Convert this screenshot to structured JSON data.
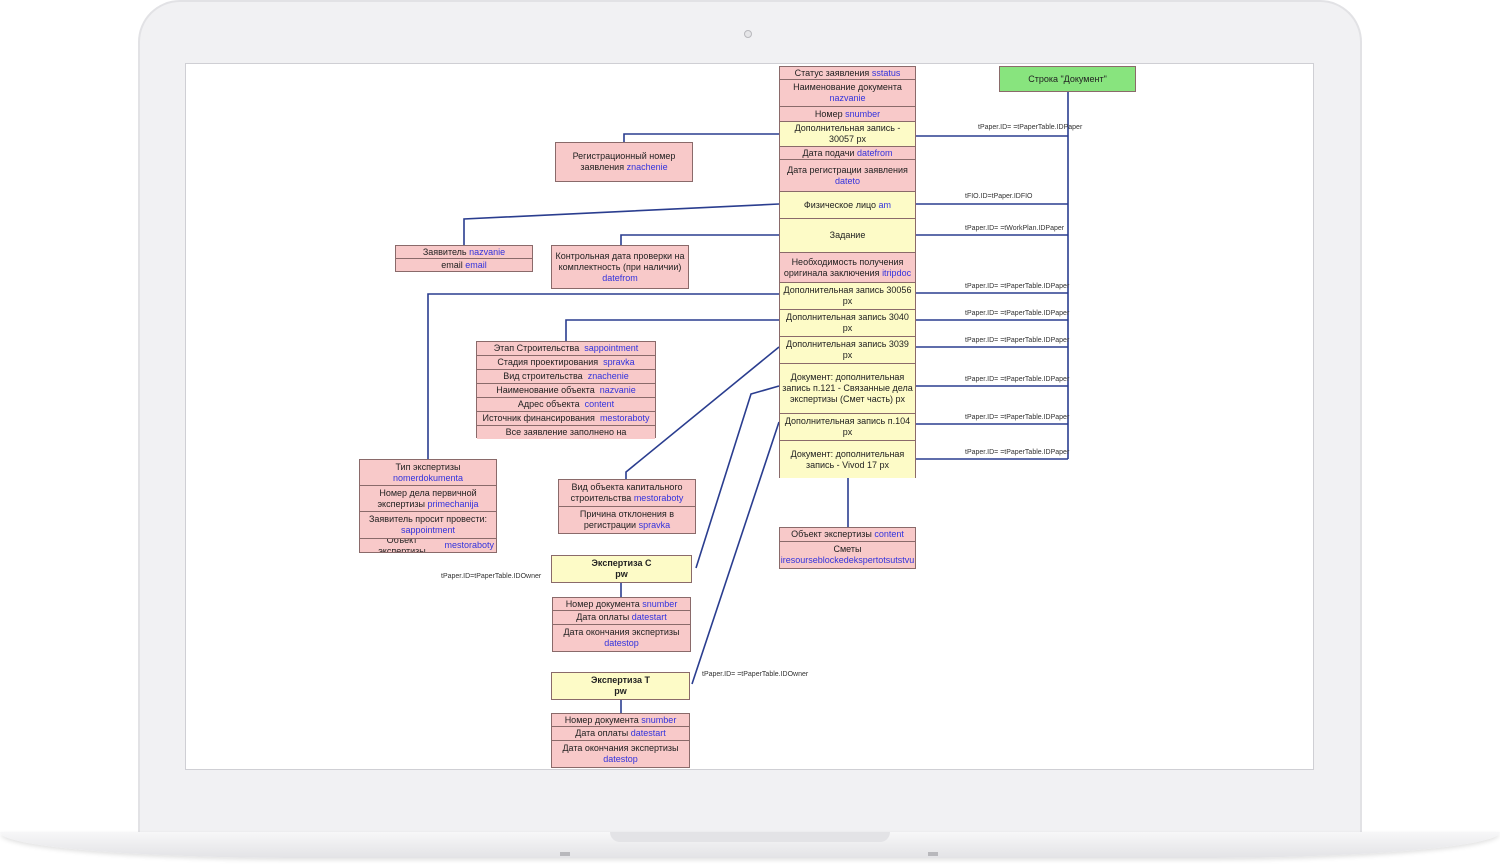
{
  "colors": {
    "pink": "#f8c9c9",
    "yellow": "#fdfbc7",
    "green": "#88e47e",
    "line": "#2a3d8f",
    "field": "#3333dd"
  },
  "document": {
    "title": "Строка \"Документ\""
  },
  "main_rows": [
    {
      "text": "Статус заявления",
      "field": "sstatus"
    },
    {
      "text": "Наименование документа",
      "field": "nazvanie"
    },
    {
      "text": "Номер",
      "field": "snumber"
    },
    {
      "text": "Дополнительная запись - 30057 px",
      "field": ""
    },
    {
      "text": "Дата подачи",
      "field": "datefrom"
    },
    {
      "text": "Дата регистрации заявления",
      "field": "dateto"
    },
    {
      "text": "Физическое лицо",
      "field": "am"
    },
    {
      "text": "Задание",
      "field": ""
    },
    {
      "text": "Необходимость получения оригинала заключения",
      "field": "itripdoc"
    },
    {
      "text": "Дополнительная запись 30056 px",
      "field": ""
    },
    {
      "text": "Дополнительная запись 3040 px",
      "field": ""
    },
    {
      "text": "Дополнительная запись 3039 px",
      "field": ""
    },
    {
      "text": "Документ: дополнительная запись п.121 - Связанные дела экспертизы (Смет часть) px",
      "field": ""
    },
    {
      "text": "Дополнительная запись п.104 px",
      "field": ""
    },
    {
      "text": "Документ: дополнительная запись - Vivod 17 px",
      "field": ""
    }
  ],
  "reg_number": [
    {
      "text": "Регистрационный номер заявления",
      "field": "znachenie"
    }
  ],
  "applicant": [
    {
      "text": "Заявитель",
      "field": "nazvanie"
    },
    {
      "text": "email",
      "field": "email"
    }
  ],
  "control_date": [
    {
      "text": "Контрольная дата проверки на комплектность (при наличии)",
      "field": "datefrom"
    }
  ],
  "stage": [
    {
      "text": "Этап Строительства",
      "field": "sappointment"
    },
    {
      "text": "Стадия проектирования",
      "field": "spravka"
    },
    {
      "text": "Вид строительства",
      "field": "znachenie"
    },
    {
      "text": "Наименование объекта",
      "field": "nazvanie"
    },
    {
      "text": "Адрес объекта",
      "field": "content"
    },
    {
      "text": "Источник финансирования",
      "field": "mestoraboty"
    },
    {
      "text": "Все заявление заполнено на",
      "field": ""
    }
  ],
  "type_block": [
    {
      "text": "Тип экспертизы",
      "field": "nomerdokumenta"
    },
    {
      "text": "Номер дела первичной экспертизы",
      "field": "primechanija"
    },
    {
      "text": "Заявитель просит провести:",
      "field": "sappointment"
    },
    {
      "text": "Объект экспертизы",
      "field": "mestoraboty"
    }
  ],
  "object_kind": [
    {
      "text": "Вид объекта капитального строительства",
      "field": "mestoraboty"
    },
    {
      "text": "Причина отклонения в регистрации",
      "field": "spravka"
    }
  ],
  "expertise_object": [
    {
      "text": "Объект экспертизы",
      "field": "content"
    },
    {
      "text": "Сметы",
      "field": "iresourseblockedekspertotsutstvu"
    }
  ],
  "exp_c": {
    "title": "Экспертиза С",
    "sub": "pw"
  },
  "exp_c_rows": [
    {
      "text": "Номер документа",
      "field": "snumber"
    },
    {
      "text": "Дата оплаты",
      "field": "datestart"
    },
    {
      "text": "Дата окончания экспертизы",
      "field": "datestop"
    }
  ],
  "exp_t": {
    "title": "Экспертиза Т",
    "sub": "pw"
  },
  "exp_t_rows": [
    {
      "text": "Номер документа",
      "field": "snumber"
    },
    {
      "text": "Дата оплаты",
      "field": "datestart"
    },
    {
      "text": "Дата окончания экспертизы",
      "field": "datestop"
    }
  ],
  "join_labels": [
    "tPaper.ID= =tPaperTable.IDPaper",
    "tFIO.ID=tPaper.IDFIO",
    "tPaper.ID= =tWorkPlan.IDPaper",
    "tPaper.ID= =tPaperTable.IDPaper",
    "tPaper.ID= =tPaperTable.IDPaper",
    "tPaper.ID= =tPaperTable.IDPaper",
    "tPaper.ID= =tPaperTable.IDPaper",
    "tPaper.ID= =tPaperTable.IDPaper",
    "tPaper.ID= =tPaperTable.IDPaper",
    "tPaper.ID=tPaperTable.IDOwner",
    "tPaper.ID= =tPaperTable.IDOwner"
  ]
}
